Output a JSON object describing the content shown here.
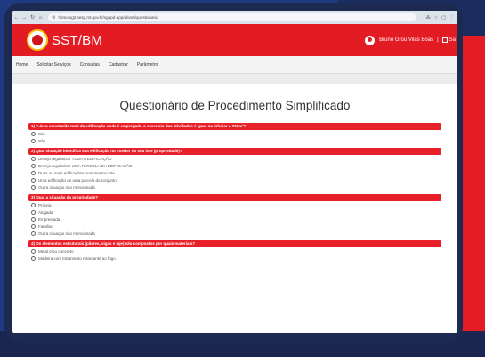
{
  "browser": {
    "url": "homolog2.sesp.mt.gov.br/sgapd-app/alvara/questionario"
  },
  "header": {
    "brand": "SST/BM",
    "user_name": "Bruno Grou Vilas Boas",
    "separator": "|",
    "logout_label": "Sa"
  },
  "menu": {
    "items": [
      "Home",
      "Solicitar Serviços",
      "Consultas",
      "Cadastrar",
      "Parâmetro"
    ]
  },
  "page": {
    "title": "Questionário de Procedimento Simplificado"
  },
  "questions": [
    {
      "text": "1) A área construída total da edificação onde é empregado o exercício das atividades é igual ou inferior a 750m²?",
      "options": [
        "Sim",
        "Não"
      ]
    },
    {
      "text": "2) Qual situação identifica sua edificação no interior do seu lote (propriedade)?",
      "options": [
        "Desejo regularizar TODA A EDIFICAÇÃO.",
        "Desejo regularizar UMA PARCELA DA EDIFICAÇÃO.",
        "Duas ou mais edificações num mesmo lote.",
        "Uma edificação de uma parcela do conjunto.",
        "Outra situação não mencionada"
      ]
    },
    {
      "text": "3) Qual a situação da propriedade?",
      "options": [
        "Própria",
        "Alugada",
        "Emprestada",
        "Familiar",
        "Outra situação não mencionada"
      ]
    },
    {
      "text": "4) Os elementos estruturais (pilares, vigas e laje) são compostos por quais materiais?",
      "options": [
        "Metal e/ou concreto",
        "Madeira com tratamento retardante ao fogo"
      ]
    }
  ],
  "colors": {
    "accent_red": "#e31b23",
    "frame_blue": "#203a82"
  }
}
